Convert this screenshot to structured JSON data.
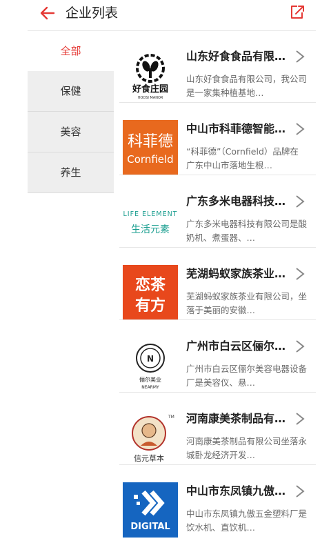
{
  "header": {
    "title": "企业列表"
  },
  "sidebar": {
    "items": [
      {
        "label": "全部"
      },
      {
        "label": "保健"
      },
      {
        "label": "美容"
      },
      {
        "label": "养生"
      }
    ]
  },
  "companies": [
    {
      "name": "山东好食食品有限公司",
      "desc": "山东好食食品有限公司，我公司是一家集种植基地…",
      "logo_text": "好食庄园",
      "logo_sub": "HOOSI MANOR"
    },
    {
      "name": "中山市科菲德智能科技",
      "desc": "“科菲德”（Cornfield）品牌在广东中山市落地生根…",
      "logo_text": "科菲德",
      "logo_sub": "Cornfield"
    },
    {
      "name": "广东多米电器科技有限公司",
      "desc": "广东多米电器科技有限公司是酸奶机、煮蛋器、…",
      "logo_text": "LIFE ELEMENT",
      "logo_sub": "生活元素"
    },
    {
      "name": "芜湖蚂蚁家族茶业有限公司",
      "desc": "芜湖蚂蚁家族茶业有限公司，坐落于美丽的安徽…",
      "logo_text": "恋茶",
      "logo_sub": "有方"
    },
    {
      "name": "广州市白云区俪尔美容电器",
      "desc": "广州市白云区俪尔美容电器设备厂是美容仪、悬…",
      "logo_text": "俪尔美业",
      "logo_sub": "NEARMY"
    },
    {
      "name": "河南康美茶制品有限公司",
      "desc": "河南康美茶制品有限公司坐落永城卧龙经济开发…",
      "logo_text": "信元草本",
      "logo_sub": "TM"
    },
    {
      "name": "中山市东凤镇九傲五金",
      "desc": "中山市东凤镇九傲五金塑料厂是饮水机、直饮机…",
      "logo_text": "DIGITAL",
      "logo_sub": ""
    }
  ]
}
